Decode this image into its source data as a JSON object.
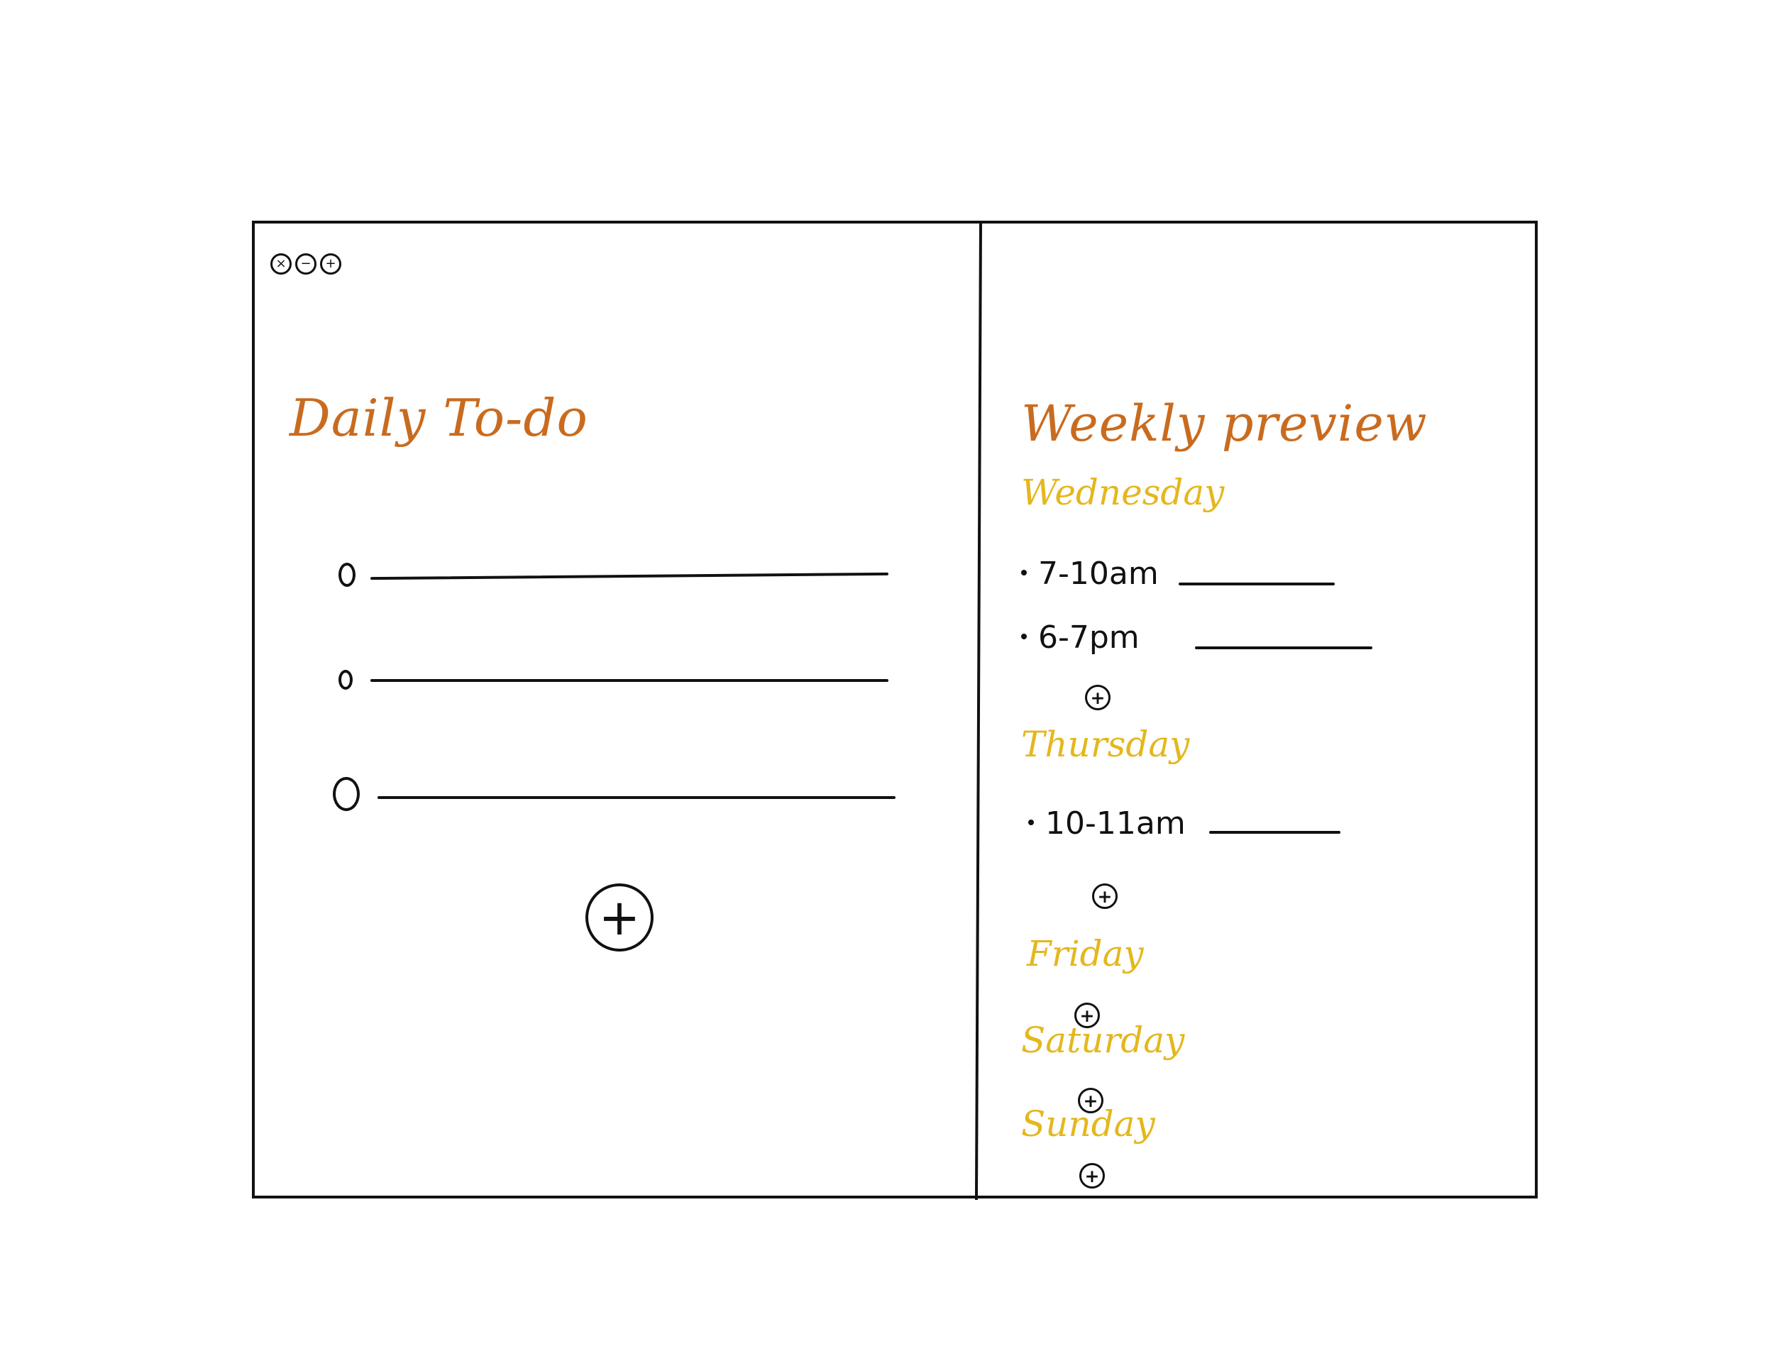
{
  "window": {
    "controls": [
      {
        "name": "close",
        "glyph": "×"
      },
      {
        "name": "minimize",
        "glyph": "−"
      },
      {
        "name": "maximize",
        "glyph": "+"
      }
    ]
  },
  "daily": {
    "title": "Daily   To-do",
    "items": [
      "",
      "",
      ""
    ],
    "add_glyph": "+"
  },
  "weekly": {
    "title": "Weekly preview",
    "days": [
      {
        "name": "Wednesday",
        "events": [
          {
            "time": "7-10am"
          },
          {
            "time": "6-7pm"
          }
        ]
      },
      {
        "name": "Thursday",
        "events": [
          {
            "time": "10-11am"
          }
        ]
      },
      {
        "name": "Friday",
        "events": []
      },
      {
        "name": "Saturday",
        "events": []
      },
      {
        "name": "Sunday",
        "events": []
      }
    ],
    "add_glyph": "+"
  },
  "colors": {
    "title_orange": "#c96b1f",
    "day_yellow": "#e4b71d",
    "ink": "#111111"
  }
}
